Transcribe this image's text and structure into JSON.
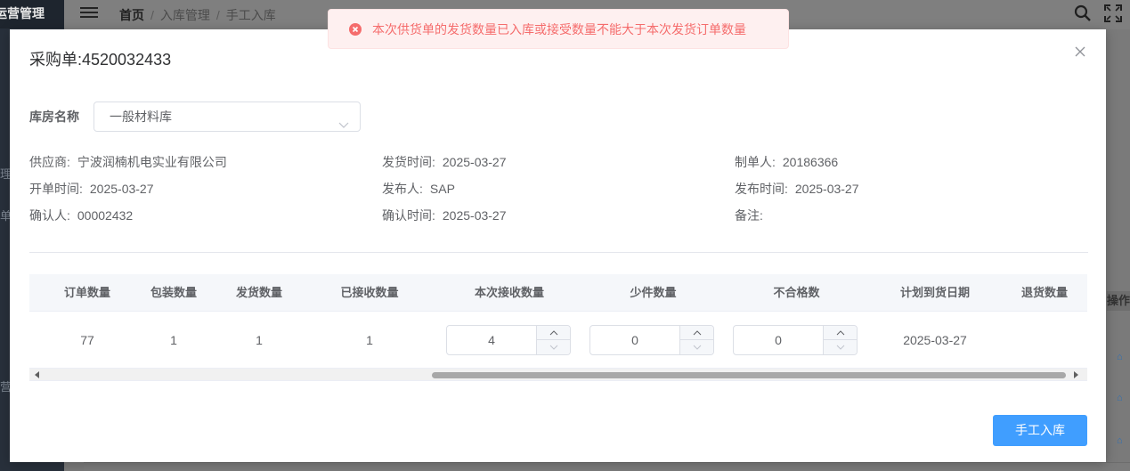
{
  "app": {
    "brand": "运营管理",
    "sidebar_fragments": [
      "理",
      "单",
      "营"
    ]
  },
  "breadcrumb": {
    "home": "首页",
    "level1": "入库管理",
    "level2": "手工入库"
  },
  "background": {
    "op_header": "操作"
  },
  "toast": {
    "type": "error",
    "message": "本次供货单的发货数量已入库或接受数量不能大于本次发货订单数量",
    "color": "#f56c6c"
  },
  "dialog": {
    "title": "采购单:4520032433",
    "warehouse": {
      "label": "库房名称",
      "value": "一般材料库"
    },
    "info": {
      "supplier": {
        "label": "供应商:",
        "value": "宁波润楠机电实业有限公司"
      },
      "ship_time": {
        "label": "发货时间:",
        "value": "2025-03-27"
      },
      "creator": {
        "label": "制单人:",
        "value": "20186366"
      },
      "open_time": {
        "label": "开单时间:",
        "value": "2025-03-27"
      },
      "publisher": {
        "label": "发布人:",
        "value": "SAP"
      },
      "publish_time": {
        "label": "发布时间:",
        "value": "2025-03-27"
      },
      "confirmer": {
        "label": "确认人:",
        "value": "00002432"
      },
      "confirm_time": {
        "label": "确认时间:",
        "value": "2025-03-27"
      },
      "remark": {
        "label": "备注:",
        "value": ""
      }
    },
    "table": {
      "headers": [
        "订单数量",
        "包装数量",
        "发货数量",
        "已接收数量",
        "本次接收数量",
        "少件数量",
        "不合格数",
        "计划到货日期",
        "退货数量"
      ],
      "row": {
        "order_qty": "77",
        "package_qty": "1",
        "ship_qty": "1",
        "received_qty": "1",
        "this_receive_qty": "4",
        "short_qty": "0",
        "unqualified_qty": "0",
        "planned_date": "2025-03-27",
        "return_qty": ""
      }
    },
    "submit_label": "手工入库",
    "accent_color": "#409eff"
  }
}
